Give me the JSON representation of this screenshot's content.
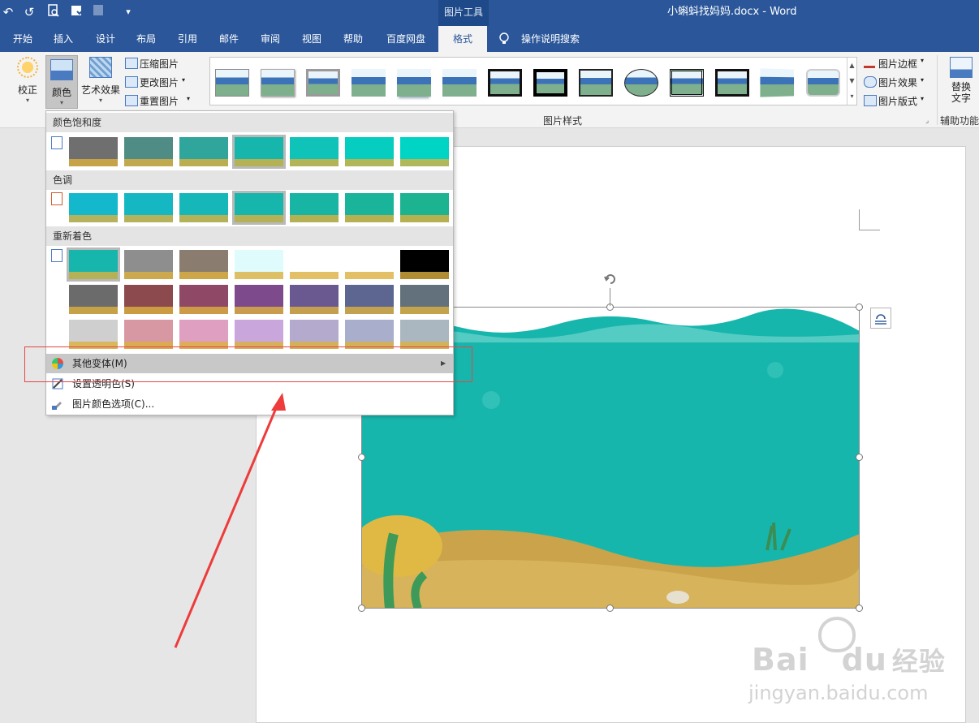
{
  "window": {
    "title": "小蝌蚪找妈妈.docx  -  Word",
    "context_tab_group": "图片工具"
  },
  "qat": {
    "undo": "↶",
    "redo": "↺",
    "customize": "▾"
  },
  "tabs": [
    "开始",
    "插入",
    "设计",
    "布局",
    "引用",
    "邮件",
    "审阅",
    "视图",
    "帮助",
    "百度网盘",
    "格式"
  ],
  "active_tab": "格式",
  "tell_me": "操作说明搜索",
  "ribbon": {
    "adjust": {
      "correct": "校正",
      "color": "颜色",
      "artistic": "艺术效果",
      "compress": "压缩图片",
      "change": "更改图片",
      "reset": "重置图片"
    },
    "styles_group_label": "图片样式",
    "picture_border": "图片边框",
    "picture_effects": "图片效果",
    "picture_layout": "图片版式",
    "alt_text_line1": "替换",
    "alt_text_line2": "文字",
    "accessibility_group_label": "辅助功能"
  },
  "color_menu": {
    "saturation_header": "颜色饱和度",
    "tone_header": "色调",
    "recolor_header": "重新着色",
    "more_variations": "其他变体(M)",
    "set_transparent": "设置透明色(S)",
    "color_options": "图片颜色选项(C)..."
  },
  "watermark": {
    "brand": "Bai",
    "brand2": "du",
    "text": "经验",
    "url": "jingyan.baidu.com"
  }
}
